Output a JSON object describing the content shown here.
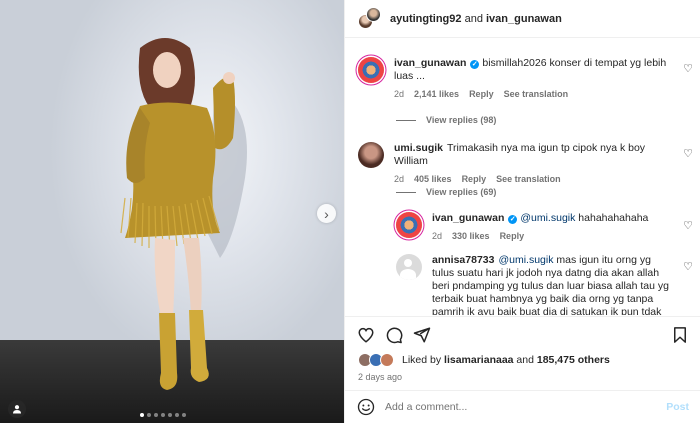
{
  "colors": {
    "accent": "#0095f6",
    "muted": "#737373",
    "text": "#262626",
    "post_disabled": "#b2dffc",
    "ring": "#d6249f"
  },
  "header": {
    "user1": "ayutingting92",
    "connector": "and",
    "user2": "ivan_gunawan"
  },
  "comments": [
    {
      "username": "ivan_gunawan",
      "verified": true,
      "text": "bismillah2026 konser di tempat yg lebih luas ...",
      "age": "2d",
      "likes": "2,141 likes",
      "reply": "Reply",
      "translate": "See translation",
      "view_replies": "View replies (98)"
    },
    {
      "username": "umi.sugik",
      "verified": false,
      "text": "Trimakasih nya ma igun tp cipok nya k boy William",
      "age": "2d",
      "likes": "405 likes",
      "reply": "Reply",
      "translate": "See translation",
      "view_replies": "View replies (69)"
    }
  ],
  "replies": [
    {
      "username": "ivan_gunawan",
      "verified": true,
      "mention": "@umi.sugik",
      "text": "hahahahahaha",
      "age": "2d",
      "likes": "330 likes",
      "reply": "Reply"
    },
    {
      "username": "annisa78733",
      "mention": "@umi.sugik",
      "text": "mas igun itu orng yg tulus suatu hari jk jodoh nya datng dia akan allah beri pndamping yg tulus dan luar biasa allah tau yg terbaik buat hambnya yg baik dia orng yg tanpa pamrih jk ayu baik buat dia di satukan jk pun tdak yakin saya yg"
    }
  ],
  "liked_by": {
    "prefix": "Liked by",
    "user": "lisamarianaaa",
    "joiner": "and",
    "others": "185,475 others"
  },
  "post_time": "2 days ago",
  "add_comment": {
    "placeholder": "Add a comment...",
    "post_label": "Post"
  },
  "carousel": {
    "slides": 7,
    "active_index": 0
  },
  "icons": [
    "heart-icon",
    "comment-icon",
    "share-icon",
    "bookmark-icon",
    "emoji-icon",
    "chevron-right-icon",
    "user-tag-icon",
    "verified-badge-icon"
  ]
}
